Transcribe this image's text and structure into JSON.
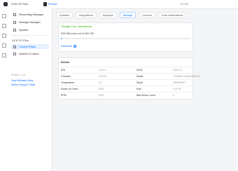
{
  "topbar": {
    "app_title": "UCK G2 Plus",
    "protect_label": "Protect",
    "user": "Tuto95"
  },
  "sidebar": {
    "items": [
      {
        "label": "Recording Manager",
        "icon": "recording-icon"
      },
      {
        "label": "Storage Manager",
        "icon": "storage-icon"
      },
      {
        "label": "System",
        "icon": "system-icon"
      }
    ],
    "device_name": "UCK G2 Plus",
    "device_items": [
      {
        "label": "Control Plane",
        "icon": "control-plane-icon",
        "active": true
      },
      {
        "label": "Admins & Users",
        "icon": "users-icon"
      }
    ],
    "version": "Protect 1.3.6",
    "links": [
      "View Release Notes",
      "Submit Support Ticket"
    ]
  },
  "tabs": [
    "Updates",
    "Integrations",
    "Backups",
    "Storage",
    "Console",
    "Push Notifications"
  ],
  "active_tab": "Storage",
  "storage_pool": {
    "status": "Storage Pool: Operational",
    "usage": "425 MB used out of 940 GB",
    "usage_fraction": 0.0005,
    "reformat_label": "Reformat"
  },
  "drives": {
    "title": "Drives",
    "rows": [
      [
        "ATA",
        "ACS-3",
        "SATA",
        "SATA 3.1"
      ],
      [
        "Firmware",
        "5.05.AC",
        "Model",
        "TOSHIBA HQ2A406F100"
      ],
      [
        "Temperature",
        "33°",
        "Serial",
        "Z3K8950UT"
      ],
      [
        "Power on Hours",
        "8690",
        "Size",
        "1.00 TB"
      ],
      [
        "RPM",
        "5400",
        "Bad Sector Count",
        "0"
      ]
    ]
  },
  "colors": {
    "accent": "#006fff",
    "success": "#38b000"
  }
}
